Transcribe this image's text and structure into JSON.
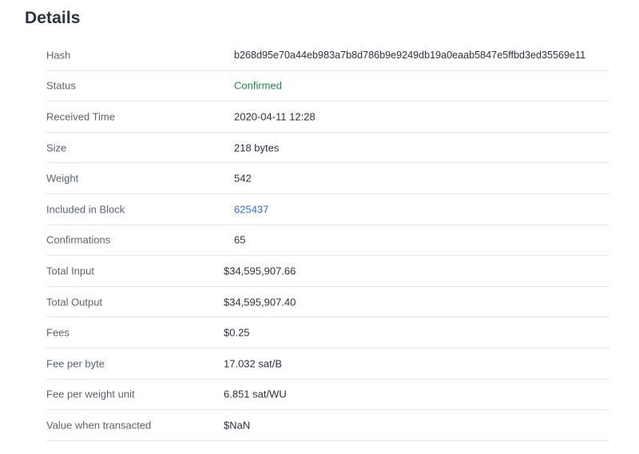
{
  "page": {
    "title": "Details"
  },
  "details": {
    "hash": {
      "label": "Hash",
      "value": "b268d95e70a44eb983a7b8d786b9e9249db19a0eaab5847e5ffbd3ed35569e11"
    },
    "status": {
      "label": "Status",
      "value": "Confirmed"
    },
    "received_time": {
      "label": "Received Time",
      "value": "2020-04-11 12:28"
    },
    "size": {
      "label": "Size",
      "value": "218 bytes"
    },
    "weight": {
      "label": "Weight",
      "value": "542"
    },
    "included_in_block": {
      "label": "Included in Block",
      "value": "625437"
    },
    "confirmations": {
      "label": "Confirmations",
      "value": "65"
    },
    "total_input": {
      "label": "Total Input",
      "value": "$34,595,907.66"
    },
    "total_output": {
      "label": "Total Output",
      "value": "$34,595,907.40"
    },
    "fees": {
      "label": "Fees",
      "value": "$0.25"
    },
    "fee_per_byte": {
      "label": "Fee per byte",
      "value": "17.032 sat/B"
    },
    "fee_per_weight_unit": {
      "label": "Fee per weight unit",
      "value": "6.851 sat/WU"
    },
    "value_when_transacted": {
      "label": "Value when transacted",
      "value": "$NaN"
    }
  },
  "colors": {
    "status_confirmed": "#1e8a4c",
    "link": "#2f6ee0",
    "divider": "#e6e8eb"
  }
}
